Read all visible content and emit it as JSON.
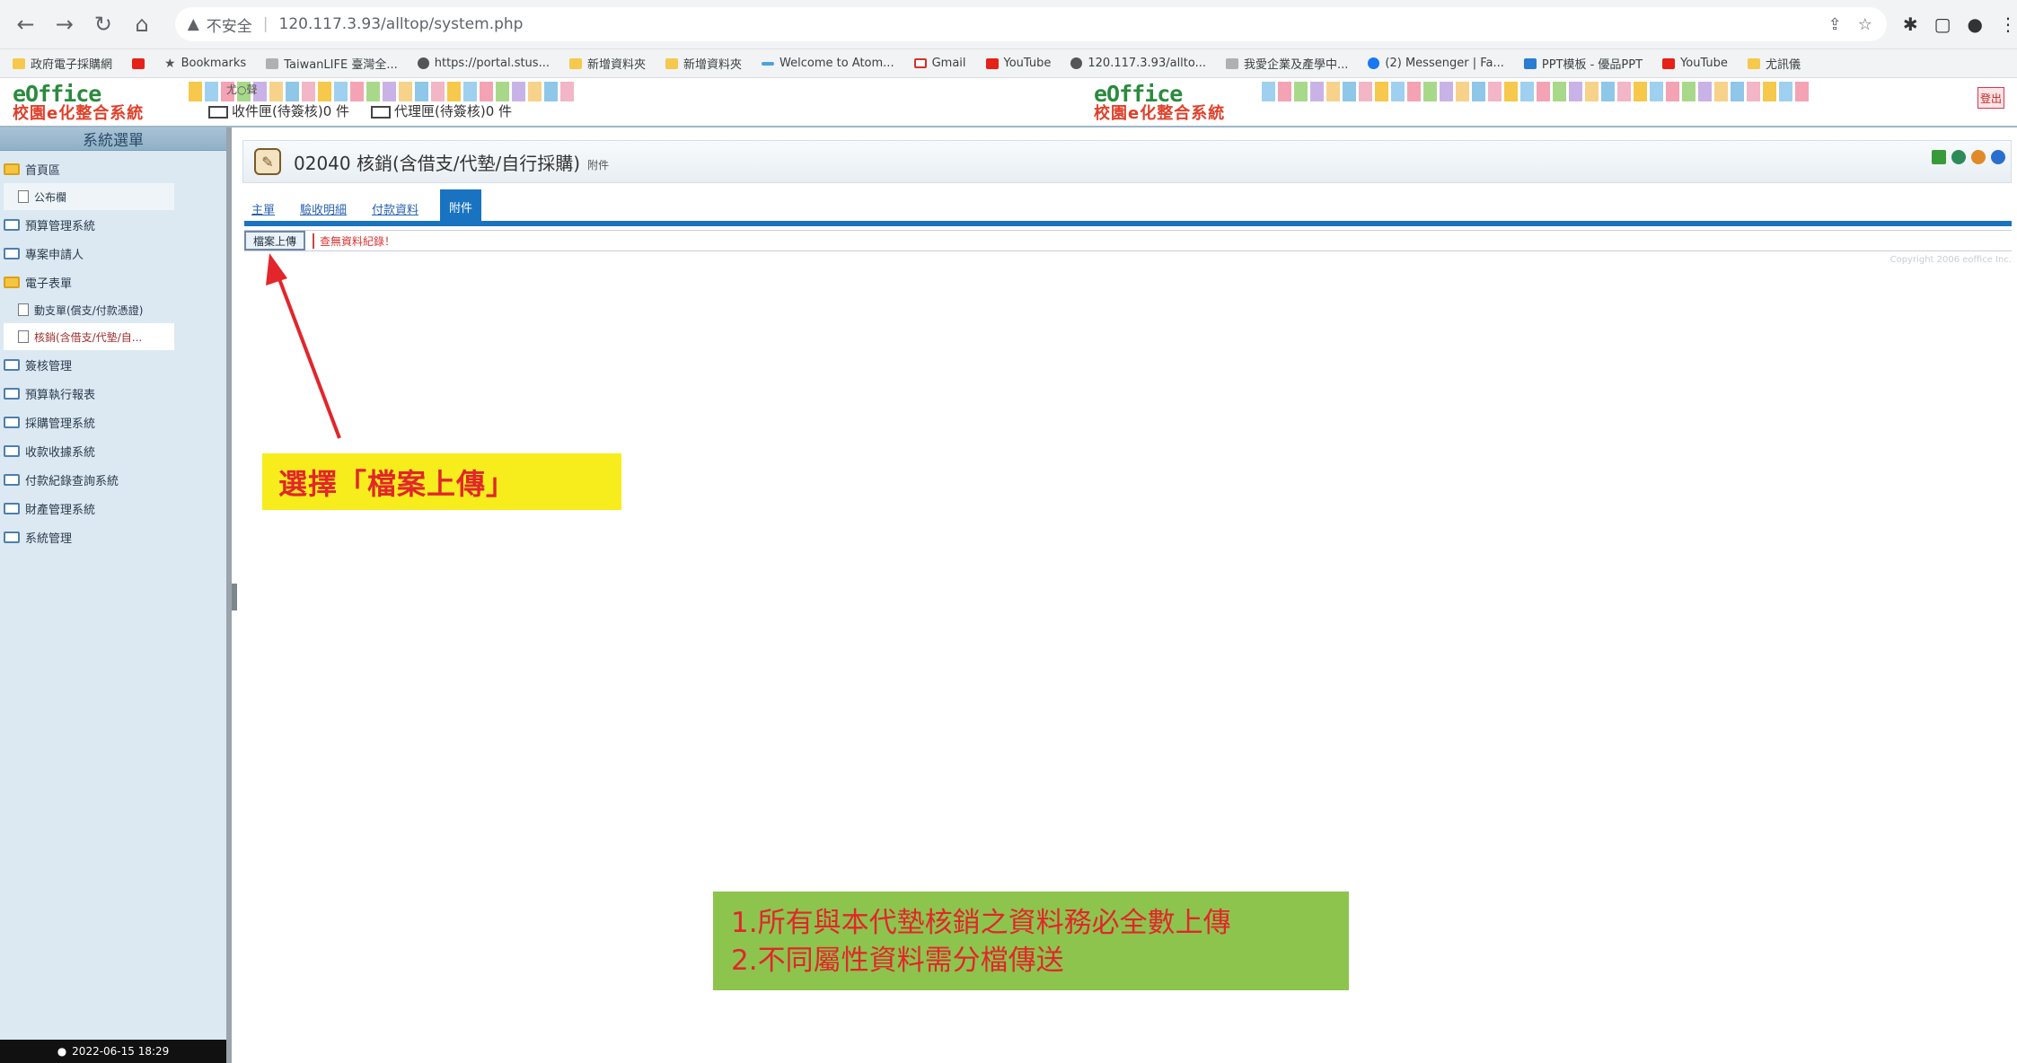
{
  "browser": {
    "insecure_label": "不安全",
    "url": "120.117.3.93/alltop/system.php",
    "bookmarks": [
      {
        "label": "政府電子採購網",
        "icon": "folder-icon"
      },
      {
        "label": "",
        "icon": "youtube-icon"
      },
      {
        "label": "Bookmarks",
        "icon": "star-icon"
      },
      {
        "label": "TaiwanLIFE 臺灣全...",
        "icon": "taiwanlife-icon"
      },
      {
        "label": "https://portal.stus...",
        "icon": "globe-icon"
      },
      {
        "label": "新增資料夾",
        "icon": "folder-icon"
      },
      {
        "label": "新增資料夾",
        "icon": "folder-icon"
      },
      {
        "label": "Welcome to Atom...",
        "icon": "atom-icon"
      },
      {
        "label": "Gmail",
        "icon": "gmail-icon"
      },
      {
        "label": "YouTube",
        "icon": "youtube-icon"
      },
      {
        "label": "120.117.3.93/allto...",
        "icon": "globe-icon"
      },
      {
        "label": "我愛企業及產學中...",
        "icon": "leaf-icon"
      },
      {
        "label": "(2) Messenger | Fa...",
        "icon": "facebook-icon"
      },
      {
        "label": "PPT模板 - 優品PPT",
        "icon": "ppt-icon"
      },
      {
        "label": "YouTube",
        "icon": "youtube-icon"
      },
      {
        "label": "尤訊儀",
        "icon": "folder-icon"
      }
    ]
  },
  "header": {
    "logo_name": "eOffice",
    "logo_sub": "校園e化整合系統",
    "user_name": "尤○聲",
    "inbox_label": "收件匣(待簽核)0 件",
    "proxy_label": "代理匣(待簽核)0 件",
    "logout_label": "登出"
  },
  "sidebar": {
    "title": "系統選單",
    "items": [
      {
        "label": "首頁區",
        "type": "folder-open"
      },
      {
        "label": "公布欄",
        "type": "doc"
      },
      {
        "label": "預算管理系統",
        "type": "folder"
      },
      {
        "label": "專案申請人",
        "type": "folder"
      },
      {
        "label": "電子表單",
        "type": "folder-open"
      },
      {
        "label": "動支單(償支/付款憑證)",
        "type": "doc"
      },
      {
        "label": "核銷(含借支/代墊/自...",
        "type": "doc-current"
      },
      {
        "label": "簽核管理",
        "type": "folder"
      },
      {
        "label": "預算執行報表",
        "type": "folder"
      },
      {
        "label": "採購管理系統",
        "type": "folder"
      },
      {
        "label": "收款收據系統",
        "type": "folder"
      },
      {
        "label": "付款紀錄查詢系統",
        "type": "folder"
      },
      {
        "label": "財產管理系統",
        "type": "folder"
      },
      {
        "label": "系統管理",
        "type": "folder"
      }
    ],
    "clock": "2022-06-15 18:29"
  },
  "main": {
    "page_title": "02040 核銷(含借支/代墊/自行採購)",
    "page_title_sub": "附件",
    "tabs": [
      {
        "label": "主單",
        "active": false
      },
      {
        "label": "驗收明細",
        "active": false
      },
      {
        "label": "付款資料",
        "active": false
      },
      {
        "label": "附件",
        "active": true
      }
    ],
    "upload_button": "檔案上傳",
    "no_data": "查無資料紀錄！",
    "copyright": "Copyright 2006 eoffice Inc."
  },
  "annotations": {
    "upload_callout": "選擇「檔案上傳」",
    "note_1": "1.所有與本代墊核銷之資料務必全數上傳",
    "note_2": "2.不同屬性資料需分檔傳送"
  },
  "colors": {
    "tab_accent": "#1a73c0",
    "callout_yellow": "#f7ec1c",
    "callout_green": "#8dc44d",
    "annotation_red": "#e2262b"
  }
}
